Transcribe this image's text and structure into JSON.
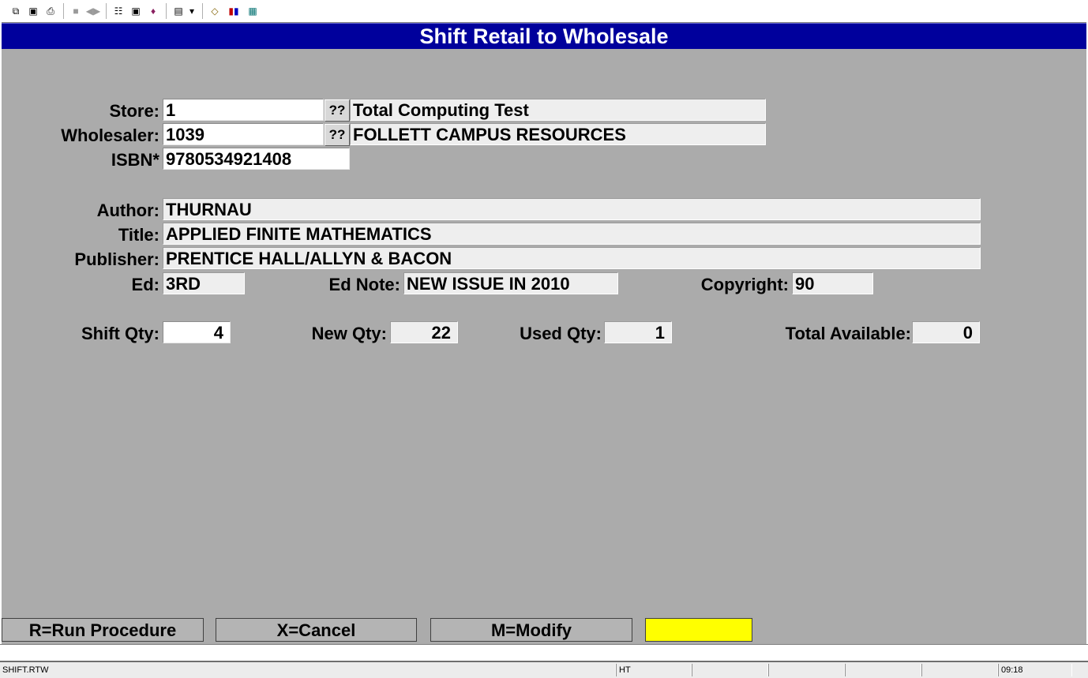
{
  "toolbar": {
    "icons": [
      "copy-icon",
      "save-icon",
      "print-icon",
      "lock-icon",
      "audio-icon",
      "properties-icon",
      "monitor-icon",
      "book-icon",
      "document-icon",
      "dropdown-arrow-icon",
      "connections-icon",
      "bar-chart-icon",
      "calculator-icon"
    ]
  },
  "window": {
    "title": "Shift Retail to Wholesale"
  },
  "form": {
    "store": {
      "label": "Store:",
      "value": "1",
      "lookup": "??",
      "description": "Total Computing Test"
    },
    "wholesaler": {
      "label": "Wholesaler:",
      "value": "1039",
      "lookup": "??",
      "description": "FOLLETT CAMPUS RESOURCES"
    },
    "isbn": {
      "label": "ISBN*",
      "value": "9780534921408"
    },
    "author": {
      "label": "Author:",
      "value": "THURNAU"
    },
    "title": {
      "label": "Title:",
      "value": "APPLIED FINITE MATHEMATICS"
    },
    "publisher": {
      "label": "Publisher:",
      "value": "PRENTICE HALL/ALLYN & BACON"
    },
    "ed": {
      "label": "Ed:",
      "value": "3RD"
    },
    "ed_note": {
      "label": "Ed Note:",
      "value": "NEW ISSUE IN 2010"
    },
    "copyright": {
      "label": "Copyright:",
      "value": "90"
    },
    "shift_qty": {
      "label": "Shift Qty:",
      "value": "4"
    },
    "new_qty": {
      "label": "New Qty:",
      "value": "22"
    },
    "used_qty": {
      "label": "Used Qty:",
      "value": "1"
    },
    "total_available": {
      "label": "Total Available:",
      "value": "0"
    }
  },
  "function_keys": {
    "run": "R=Run Procedure",
    "cancel": "X=Cancel",
    "modify": "M=Modify"
  },
  "status_bar": {
    "program": "SHIFT.RTW",
    "user": "HT",
    "time": "09:18"
  },
  "colors": {
    "title_bar": "#00009c",
    "background": "#ababab",
    "highlight": "#ffff00"
  }
}
